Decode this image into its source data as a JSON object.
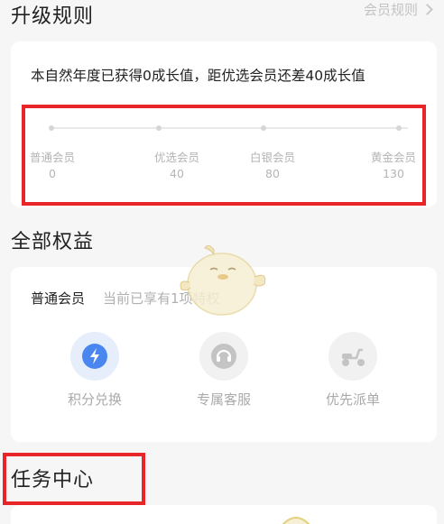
{
  "upgrade": {
    "title": "升级规则",
    "rules_link": "会员规则",
    "description": "本自然年度已获得0成长值，距优选会员还差40成长值",
    "levels": [
      {
        "name": "普通会员",
        "value": "0"
      },
      {
        "name": "优选会员",
        "value": "40"
      },
      {
        "name": "白银会员",
        "value": "80"
      },
      {
        "name": "黄金会员",
        "value": "130"
      }
    ]
  },
  "rights": {
    "title": "全部权益",
    "level_name": "普通会员",
    "subtitle": "当前已享有1项特权",
    "benefits": [
      {
        "label": "积分兑换",
        "icon": "lightning-icon",
        "active": true
      },
      {
        "label": "专属客服",
        "icon": "headset-icon",
        "active": false
      },
      {
        "label": "优先派单",
        "icon": "scooter-icon",
        "active": false
      }
    ]
  },
  "tasks": {
    "title": "任务中心"
  },
  "colors": {
    "accent_blue": "#4a86f0",
    "highlight_red": "#e8262a"
  }
}
